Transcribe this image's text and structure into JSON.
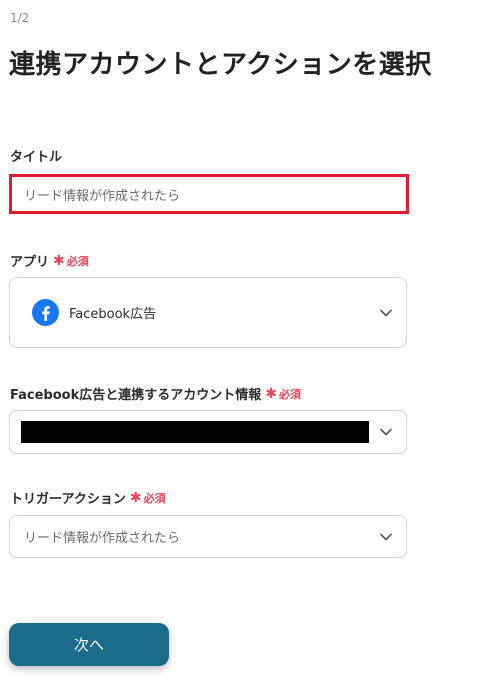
{
  "header": {
    "step": "1/2",
    "title": "連携アカウントとアクションを選択"
  },
  "form": {
    "title_field": {
      "label": "タイトル",
      "value": "リード情報が作成されたら"
    },
    "app_field": {
      "label": "アプリ",
      "required_label": "必須",
      "selected_app": "Facebook広告",
      "icon": "facebook-icon"
    },
    "account_field": {
      "label": "Facebook広告と連携するアカウント情報",
      "required_label": "必須",
      "value_redacted": true
    },
    "trigger_field": {
      "label": "トリガーアクション",
      "required_label": "必須",
      "value": "リード情報が作成されたら"
    }
  },
  "actions": {
    "next_label": "次へ"
  },
  "colors": {
    "accent": "#1a6c8a",
    "required": "#e8455a",
    "highlight_border": "#e21b2c",
    "facebook": "#1877f2"
  }
}
